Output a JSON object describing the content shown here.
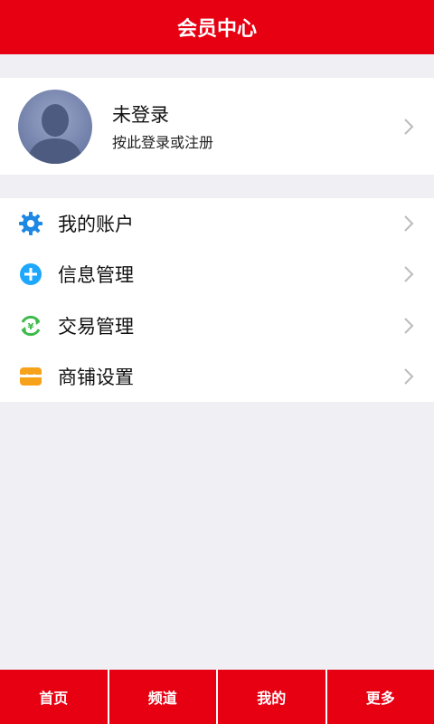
{
  "header": {
    "title": "会员中心"
  },
  "profile": {
    "name": "未登录",
    "subtitle": "按此登录或注册"
  },
  "menu": {
    "items": [
      {
        "label": "我的账户",
        "icon": "gear-icon",
        "color": "#1e88e5"
      },
      {
        "label": "信息管理",
        "icon": "plus-circle-icon",
        "color": "#1ea7fd"
      },
      {
        "label": "交易管理",
        "icon": "yuan-exchange-icon",
        "color": "#3dbb4a"
      },
      {
        "label": "商铺设置",
        "icon": "store-icon",
        "color": "#f7a21b"
      }
    ]
  },
  "tabbar": {
    "tabs": [
      {
        "label": "首页"
      },
      {
        "label": "频道"
      },
      {
        "label": "我的"
      },
      {
        "label": "更多"
      }
    ]
  },
  "colors": {
    "brand": "#e60012",
    "background": "#efeff4"
  }
}
